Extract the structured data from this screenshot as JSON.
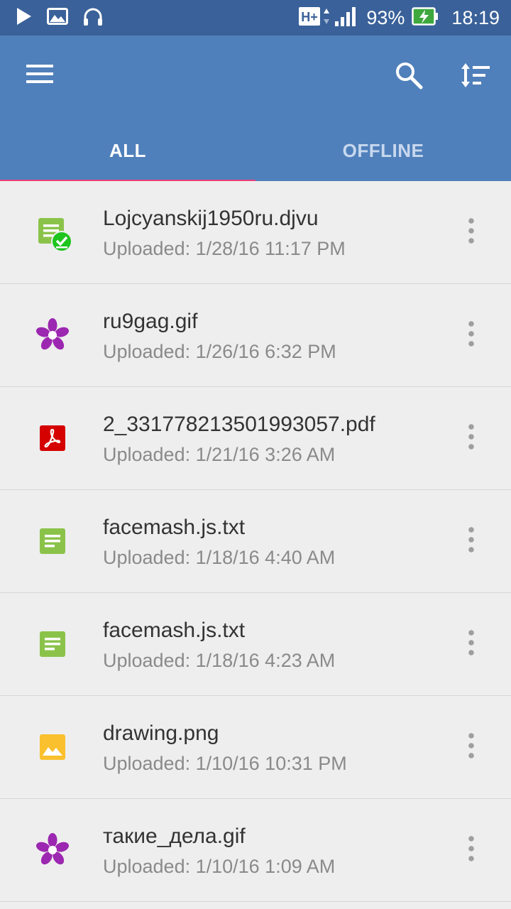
{
  "status_bar": {
    "network": "H+",
    "battery_percent": "93%",
    "time": "18:19",
    "left_icons": [
      "play-icon",
      "image-icon",
      "headphones-icon"
    ]
  },
  "app_bar": {
    "menu_icon": "menu-icon",
    "search_icon": "search-icon",
    "sort_icon": "sort-icon",
    "color": "#5080bb"
  },
  "tabs": [
    {
      "label": "ALL",
      "active": true
    },
    {
      "label": "OFFLINE",
      "active": false
    }
  ],
  "files": [
    {
      "name": "Lojcyanskij1950ru.djvu",
      "uploaded": "Uploaded: 1/28/16 11:17 PM",
      "icon": "document-icon",
      "offline_badge": true
    },
    {
      "name": "ru9gag.gif",
      "uploaded": "Uploaded: 1/26/16 6:32 PM",
      "icon": "gif-icon",
      "offline_badge": false
    },
    {
      "name": "2_331778213501993057.pdf",
      "uploaded": "Uploaded: 1/21/16 3:26 AM",
      "icon": "pdf-icon",
      "offline_badge": false
    },
    {
      "name": "facemash.js.txt",
      "uploaded": "Uploaded: 1/18/16 4:40 AM",
      "icon": "document-icon",
      "offline_badge": false
    },
    {
      "name": "facemash.js.txt",
      "uploaded": "Uploaded: 1/18/16 4:23 AM",
      "icon": "document-icon",
      "offline_badge": false
    },
    {
      "name": "drawing.png",
      "uploaded": "Uploaded: 1/10/16 10:31 PM",
      "icon": "image-icon",
      "offline_badge": false
    },
    {
      "name": "такие_дела.gif",
      "uploaded": "Uploaded: 1/10/16 1:09 AM",
      "icon": "gif-icon",
      "offline_badge": false
    }
  ],
  "colors": {
    "status_bar": "#3a6199",
    "tab_indicator": "#ec407a",
    "doc_green": "#8bc34a",
    "gif_purple": "#9c27b0",
    "pdf_red": "#d50000",
    "image_yellow": "#fbc02d",
    "offline_check": "#1ec51e"
  }
}
